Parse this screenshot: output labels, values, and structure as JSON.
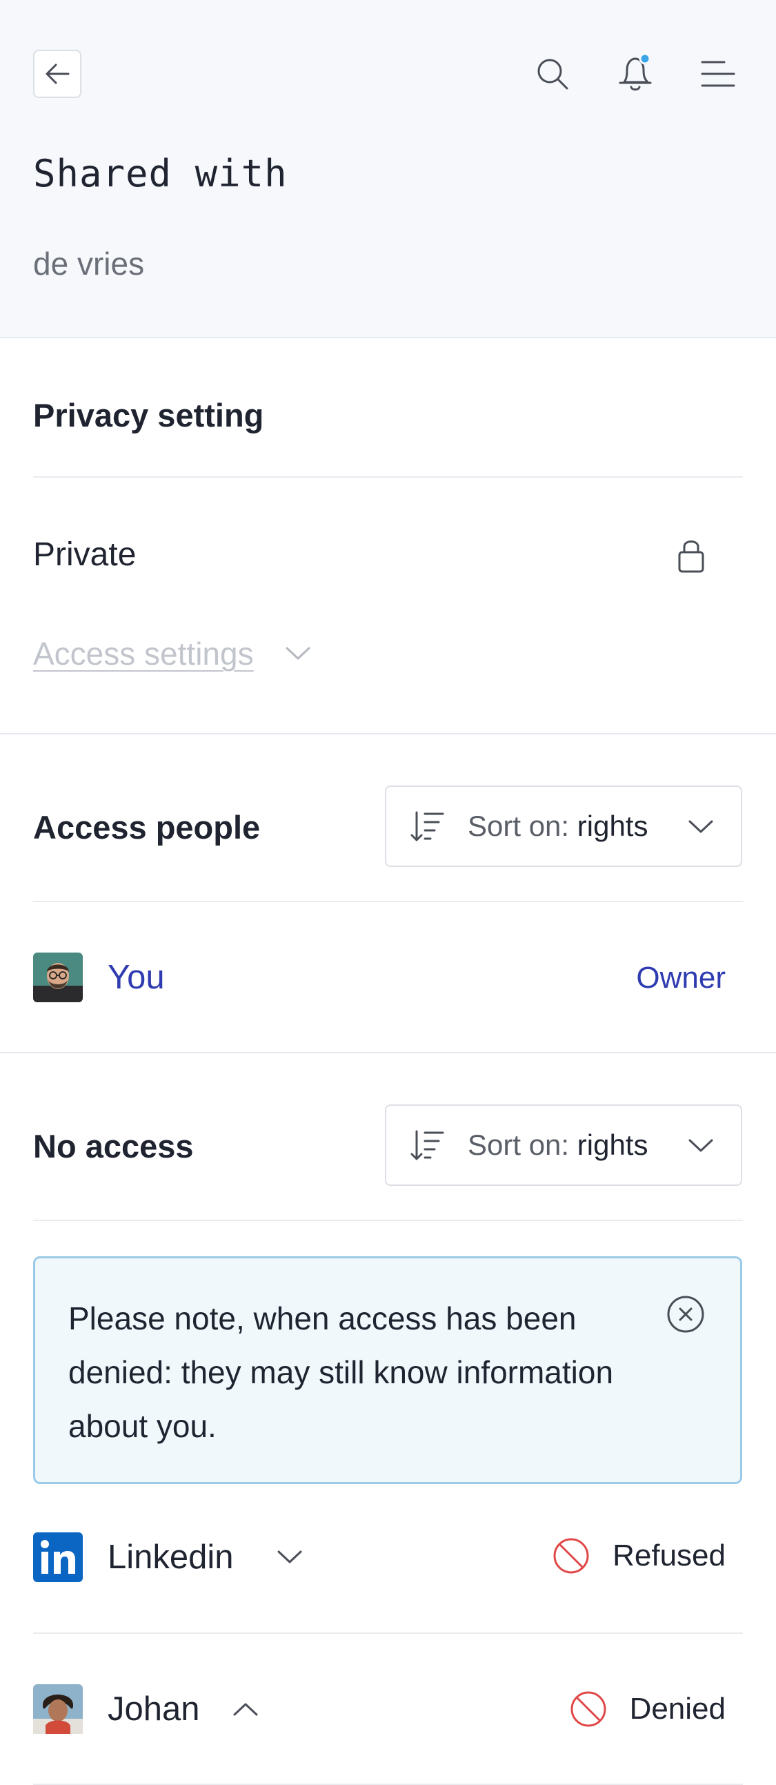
{
  "header": {
    "title": "Shared with",
    "subtitle": "de vries"
  },
  "privacy": {
    "heading": "Privacy setting",
    "value": "Private",
    "access_settings_label": "Access settings"
  },
  "access_people": {
    "heading": "Access people",
    "sort_prefix": "Sort on:",
    "sort_value": "rights",
    "people": [
      {
        "name": "You",
        "role": "Owner"
      }
    ]
  },
  "no_access": {
    "heading": "No access",
    "sort_prefix": "Sort on:",
    "sort_value": "rights",
    "notice": "Please note, when access has been denied: they may still know information about you.",
    "entries": [
      {
        "name": "Linkedin",
        "status": "Refused"
      },
      {
        "name": "Johan",
        "status": "Denied"
      }
    ]
  },
  "colors": {
    "accent": "#2f3bb0",
    "denied": "#e04848",
    "notice_border": "#9ccbe8",
    "notification_dot": "#3aa6e8",
    "linkedin": "#0a66c2"
  },
  "icons": [
    "back-arrow-icon",
    "search-icon",
    "bell-icon",
    "menu-icon",
    "lock-icon",
    "chevron-down-icon",
    "sort-icon",
    "close-circle-icon",
    "linkedin-icon",
    "prohibited-icon",
    "chevron-up-icon"
  ]
}
